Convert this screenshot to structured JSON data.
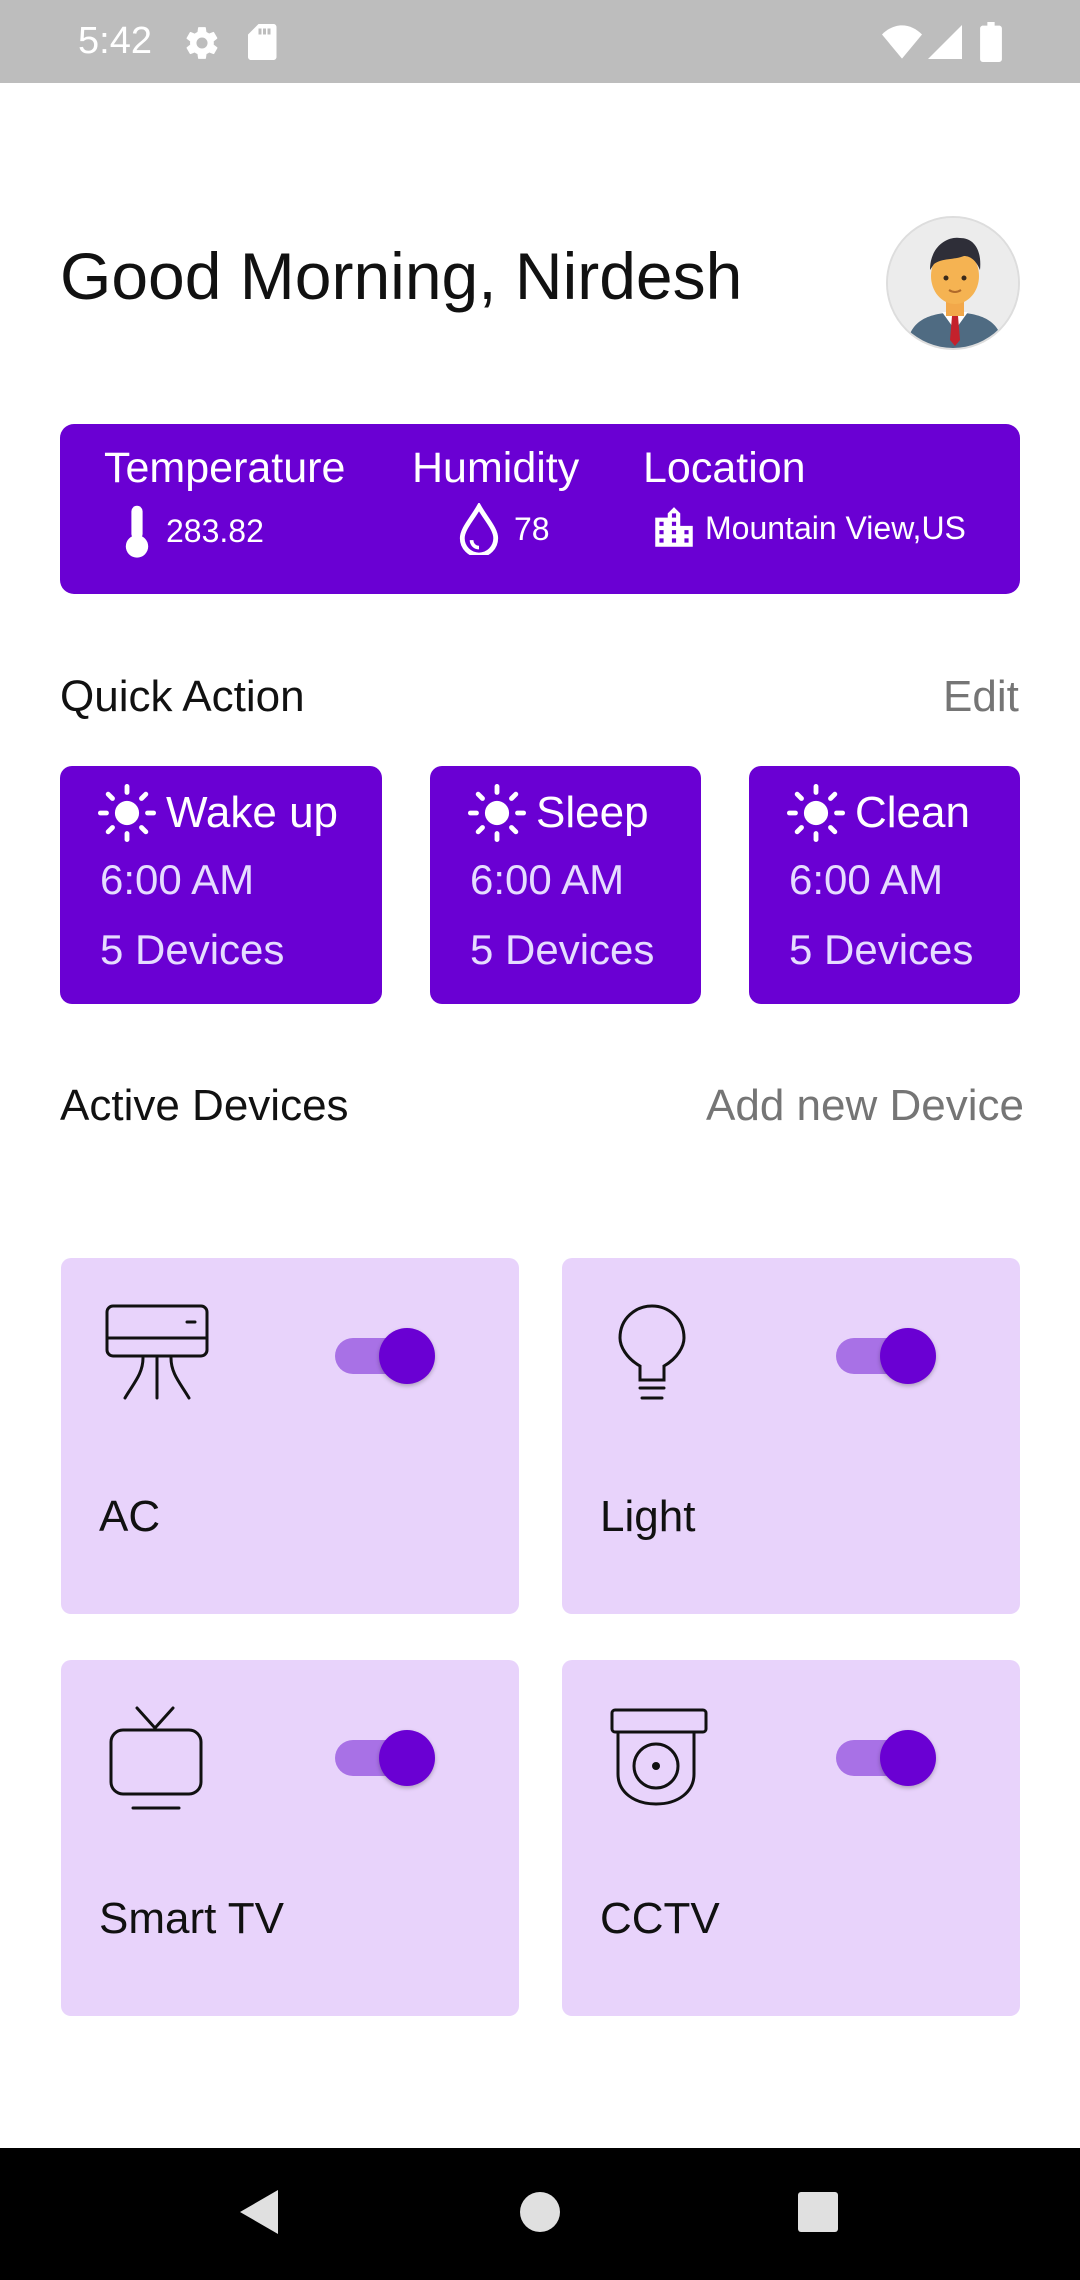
{
  "status_bar": {
    "time": "5:42"
  },
  "header": {
    "greeting": "Good Morning, Nirdesh"
  },
  "weather": {
    "temperature_label": "Temperature",
    "temperature_value": "283.82",
    "humidity_label": "Humidity",
    "humidity_value": "78",
    "location_label": "Location",
    "location_value": "Mountain View,US"
  },
  "quick_action": {
    "title": "Quick Action",
    "edit_label": "Edit",
    "cards": [
      {
        "name": "Wake up",
        "time": "6:00 AM",
        "devices": "5 Devices"
      },
      {
        "name": "Sleep",
        "time": "6:00 AM",
        "devices": "5 Devices"
      },
      {
        "name": "Clean",
        "time": "6:00 AM",
        "devices": "5 Devices"
      }
    ]
  },
  "active_devices": {
    "title": "Active Devices",
    "add_label": "Add new Device",
    "devices": [
      {
        "label": "AC",
        "icon": "air-conditioner-icon",
        "on": true
      },
      {
        "label": "Light",
        "icon": "light-bulb-icon",
        "on": true
      },
      {
        "label": "Smart TV",
        "icon": "tv-icon",
        "on": true
      },
      {
        "label": "CCTV",
        "icon": "cctv-camera-icon",
        "on": true
      }
    ]
  },
  "colors": {
    "accent": "#6a00d3",
    "device_card": "#e8d3fb",
    "toggle_track": "#a871e6",
    "status_bar": "#bdbdbd"
  }
}
